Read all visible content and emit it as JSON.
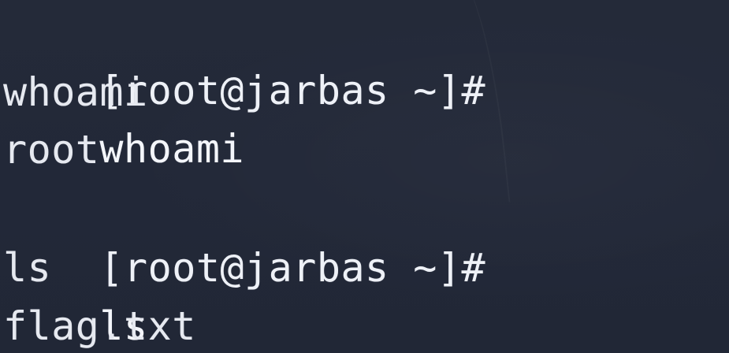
{
  "terminal": {
    "lines": [
      {
        "prompt": "[root@jarbas ~]#",
        "command": "whoami"
      },
      {
        "text": "whoami"
      },
      {
        "text": "root"
      },
      {
        "prompt": "[root@jarbas ~]#",
        "command": "ls"
      },
      {
        "text": "ls"
      },
      {
        "text": "flag.txt"
      }
    ]
  },
  "colors": {
    "background": "#232a38",
    "foreground": "#e9ecf2"
  }
}
